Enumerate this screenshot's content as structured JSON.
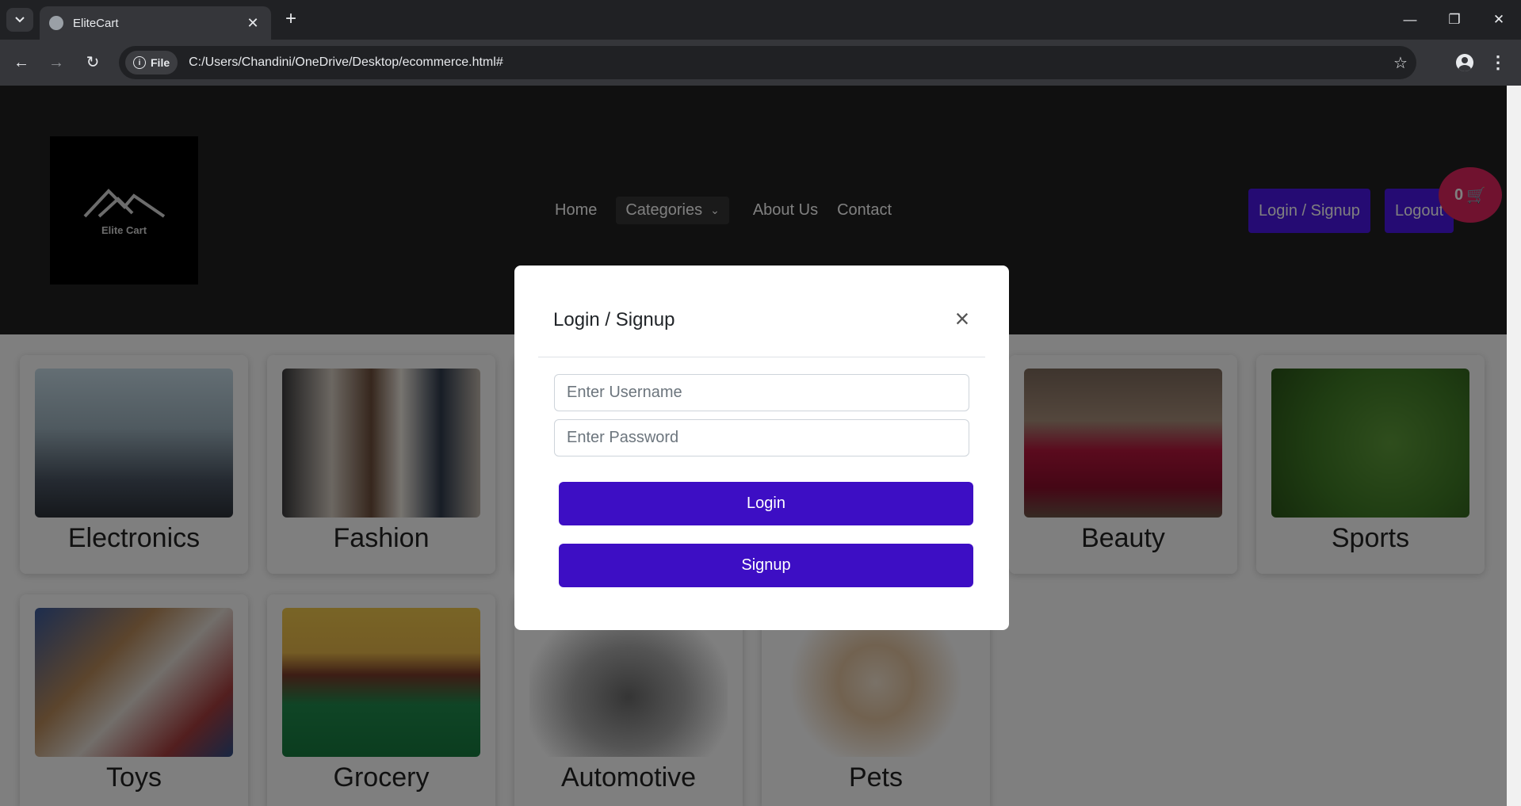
{
  "browser": {
    "tab_title": "EliteCart",
    "address_chip": "File",
    "url": "C:/Users/Chandini/OneDrive/Desktop/ecommerce.html#",
    "icons": [
      "tab-list-icon",
      "globe-icon",
      "close-icon",
      "plus-icon",
      "back-icon",
      "forward-icon",
      "reload-icon",
      "info-icon",
      "star-icon",
      "profile-icon",
      "menu-icon",
      "minimize-icon",
      "restore-icon",
      "close-window-icon"
    ]
  },
  "header": {
    "logo_text": "Elite Cart",
    "nav": {
      "home": "Home",
      "categories": "Categories",
      "about": "About Us",
      "contact": "Contact"
    },
    "login_signup": "Login / Signup",
    "logout": "Logout",
    "cart_count": "0"
  },
  "categories": [
    {
      "label": "Electronics"
    },
    {
      "label": "Fashion"
    },
    {
      "label": ""
    },
    {
      "label": ""
    },
    {
      "label": "Beauty"
    },
    {
      "label": "Sports"
    },
    {
      "label": "Toys"
    },
    {
      "label": "Grocery"
    },
    {
      "label": "Automotive"
    },
    {
      "label": "Pets"
    }
  ],
  "modal": {
    "title": "Login / Signup",
    "username_placeholder": "Enter Username",
    "password_placeholder": "Enter Password",
    "login_label": "Login",
    "signup_label": "Signup"
  },
  "colors": {
    "header_bg": "#212121",
    "accent": "#4a17e6",
    "modal_button": "#3d0ec4",
    "cart_badge": "#e0245e"
  }
}
